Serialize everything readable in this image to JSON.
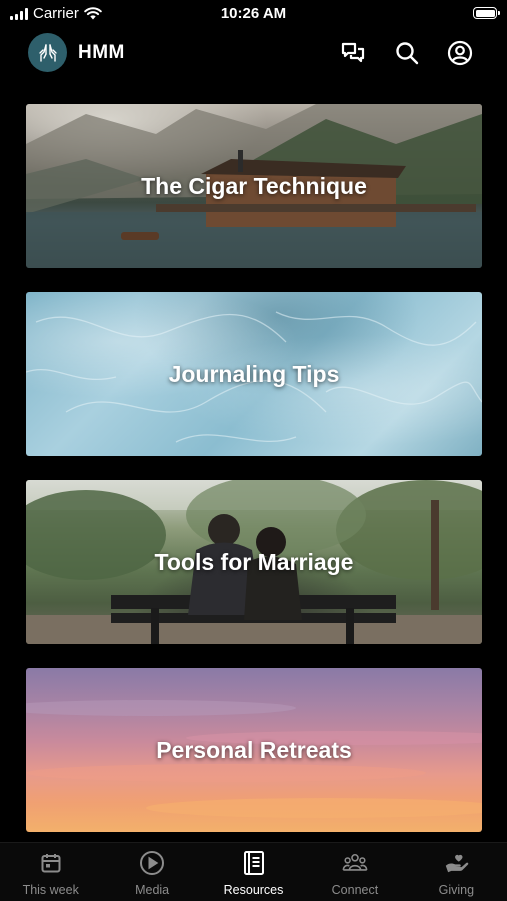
{
  "status_bar": {
    "carrier": "Carrier",
    "time": "10:26 AM"
  },
  "header": {
    "app_name": "HMM",
    "logo_icon": "praying-hands-icon",
    "actions": [
      "chat-icon",
      "search-icon",
      "profile-icon"
    ]
  },
  "cards": [
    {
      "title": "The Cigar Technique",
      "image": "lake-cabin"
    },
    {
      "title": "Journaling Tips",
      "image": "blue-ice-texture"
    },
    {
      "title": "Tools for Marriage",
      "image": "couple-on-bench"
    },
    {
      "title": "Personal Retreats",
      "image": "sunset-sky"
    }
  ],
  "tab_bar": {
    "active": "Resources",
    "tabs": [
      {
        "label": "This week",
        "icon": "calendar-icon"
      },
      {
        "label": "Media",
        "icon": "play-circle-icon"
      },
      {
        "label": "Resources",
        "icon": "book-icon"
      },
      {
        "label": "Connect",
        "icon": "group-icon"
      },
      {
        "label": "Giving",
        "icon": "giving-hand-icon"
      }
    ]
  },
  "colors": {
    "background": "#000000",
    "tab_active": "#ffffff",
    "tab_inactive": "#8c8c8c",
    "logo_bg": "#2e5f6b"
  }
}
